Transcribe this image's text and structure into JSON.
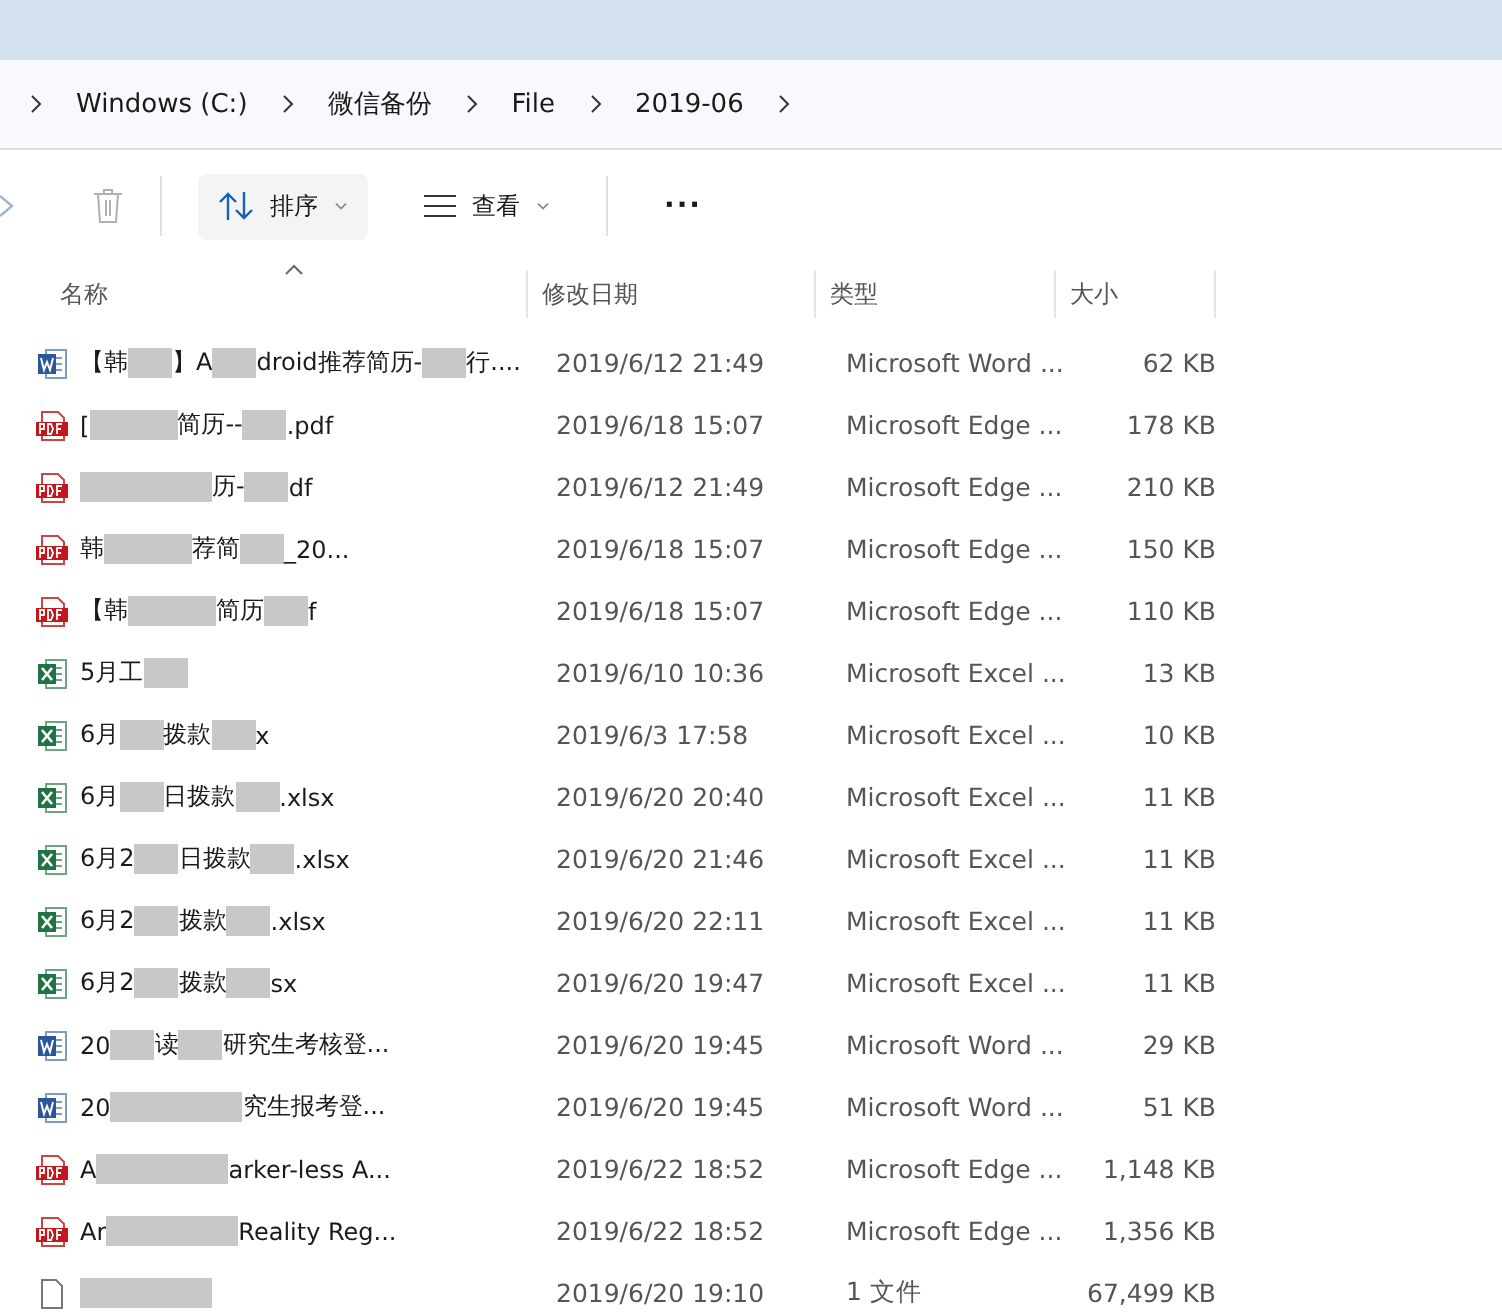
{
  "breadcrumb": [
    "Windows (C:)",
    "微信备份",
    "File",
    "2019-06"
  ],
  "toolbar": {
    "sort": "排序",
    "view": "查看",
    "more": "···"
  },
  "columns": [
    "名称",
    "修改日期",
    "类型",
    "大小"
  ],
  "rows": [
    {
      "kind": "word",
      "name": [
        {
          "kind": "text",
          "text": "【韩"
        },
        {
          "kind": "blur"
        },
        {
          "kind": "text",
          "text": "】A"
        },
        {
          "kind": "blur"
        },
        {
          "kind": "text",
          "text": "droid推荐简历-"
        },
        {
          "kind": "blur"
        },
        {
          "kind": "text",
          "text": "行...."
        }
      ],
      "date": "2019/6/12 21:49",
      "type": "Microsoft Word ...",
      "size": "62 KB"
    },
    {
      "kind": "pdf",
      "name": [
        {
          "kind": "text",
          "text": "["
        },
        {
          "kind": "blur"
        },
        {
          "kind": "blur"
        },
        {
          "kind": "text",
          "text": "简历--"
        },
        {
          "kind": "blur"
        },
        {
          "kind": "text",
          "text": ".pdf"
        }
      ],
      "date": "2019/6/18 15:07",
      "type": "Microsoft Edge ...",
      "size": "178 KB"
    },
    {
      "kind": "pdf",
      "name": [
        {
          "kind": "blur"
        },
        {
          "kind": "blur"
        },
        {
          "kind": "blur"
        },
        {
          "kind": "text",
          "text": "历-"
        },
        {
          "kind": "blur"
        },
        {
          "kind": "text",
          "text": "df"
        }
      ],
      "date": "2019/6/12 21:49",
      "type": "Microsoft Edge ...",
      "size": "210 KB"
    },
    {
      "kind": "pdf",
      "name": [
        {
          "kind": "text",
          "text": "韩"
        },
        {
          "kind": "blur"
        },
        {
          "kind": "blur"
        },
        {
          "kind": "text",
          "text": "荐简"
        },
        {
          "kind": "blur"
        },
        {
          "kind": "text",
          "text": "_20..."
        }
      ],
      "date": "2019/6/18 15:07",
      "type": "Microsoft Edge ...",
      "size": "150 KB"
    },
    {
      "kind": "pdf",
      "name": [
        {
          "kind": "text",
          "text": "【韩"
        },
        {
          "kind": "blur"
        },
        {
          "kind": "blur"
        },
        {
          "kind": "text",
          "text": "简历"
        },
        {
          "kind": "blur"
        },
        {
          "kind": "text",
          "text": "f"
        }
      ],
      "date": "2019/6/18 15:07",
      "type": "Microsoft Edge ...",
      "size": "110 KB"
    },
    {
      "kind": "excel",
      "name": [
        {
          "kind": "text",
          "text": "5月工"
        },
        {
          "kind": "blur"
        }
      ],
      "date": "2019/6/10 10:36",
      "type": "Microsoft Excel ...",
      "size": "13 KB"
    },
    {
      "kind": "excel",
      "name": [
        {
          "kind": "text",
          "text": "6月"
        },
        {
          "kind": "blur"
        },
        {
          "kind": "text",
          "text": "拨款"
        },
        {
          "kind": "blur"
        },
        {
          "kind": "text",
          "text": "x"
        }
      ],
      "date": "2019/6/3 17:58",
      "type": "Microsoft Excel ...",
      "size": "10 KB"
    },
    {
      "kind": "excel",
      "name": [
        {
          "kind": "text",
          "text": "6月"
        },
        {
          "kind": "blur"
        },
        {
          "kind": "text",
          "text": "日拨款"
        },
        {
          "kind": "blur"
        },
        {
          "kind": "text",
          "text": ".xlsx"
        }
      ],
      "date": "2019/6/20 20:40",
      "type": "Microsoft Excel ...",
      "size": "11 KB"
    },
    {
      "kind": "excel",
      "name": [
        {
          "kind": "text",
          "text": "6月2"
        },
        {
          "kind": "blur"
        },
        {
          "kind": "text",
          "text": "日拨款"
        },
        {
          "kind": "blur"
        },
        {
          "kind": "text",
          "text": ".xlsx"
        }
      ],
      "date": "2019/6/20 21:46",
      "type": "Microsoft Excel ...",
      "size": "11 KB"
    },
    {
      "kind": "excel",
      "name": [
        {
          "kind": "text",
          "text": "6月2"
        },
        {
          "kind": "blur"
        },
        {
          "kind": "text",
          "text": "拨款"
        },
        {
          "kind": "blur"
        },
        {
          "kind": "text",
          "text": ".xlsx"
        }
      ],
      "date": "2019/6/20 22:11",
      "type": "Microsoft Excel ...",
      "size": "11 KB"
    },
    {
      "kind": "excel",
      "name": [
        {
          "kind": "text",
          "text": "6月2"
        },
        {
          "kind": "blur"
        },
        {
          "kind": "text",
          "text": "拨款"
        },
        {
          "kind": "blur"
        },
        {
          "kind": "text",
          "text": "sx"
        }
      ],
      "date": "2019/6/20 19:47",
      "type": "Microsoft Excel ...",
      "size": "11 KB"
    },
    {
      "kind": "word",
      "name": [
        {
          "kind": "text",
          "text": "20"
        },
        {
          "kind": "blur"
        },
        {
          "kind": "text",
          "text": "读"
        },
        {
          "kind": "blur"
        },
        {
          "kind": "text",
          "text": "研究生考核登..."
        }
      ],
      "date": "2019/6/20 19:45",
      "type": "Microsoft Word ...",
      "size": "29 KB"
    },
    {
      "kind": "word",
      "name": [
        {
          "kind": "text",
          "text": "20"
        },
        {
          "kind": "blur"
        },
        {
          "kind": "blur"
        },
        {
          "kind": "blur"
        },
        {
          "kind": "text",
          "text": "究生报考登..."
        }
      ],
      "date": "2019/6/20 19:45",
      "type": "Microsoft Word ...",
      "size": "51 KB"
    },
    {
      "kind": "pdf",
      "name": [
        {
          "kind": "text",
          "text": "A"
        },
        {
          "kind": "blur"
        },
        {
          "kind": "blur"
        },
        {
          "kind": "blur"
        },
        {
          "kind": "text",
          "text": "arker-less A..."
        }
      ],
      "date": "2019/6/22 18:52",
      "type": "Microsoft Edge ...",
      "size": "1,148 KB"
    },
    {
      "kind": "pdf",
      "name": [
        {
          "kind": "text",
          "text": "Ar"
        },
        {
          "kind": "blur"
        },
        {
          "kind": "blur"
        },
        {
          "kind": "blur"
        },
        {
          "kind": "text",
          "text": "Reality Reg..."
        }
      ],
      "date": "2019/6/22 18:52",
      "type": "Microsoft Edge ...",
      "size": "1,356 KB"
    },
    {
      "kind": "file",
      "name": [
        {
          "kind": "blur"
        },
        {
          "kind": "blur"
        },
        {
          "kind": "blur"
        }
      ],
      "date": "2019/6/20 19:10",
      "type": "1 文件",
      "size": "67,499 KB"
    }
  ]
}
